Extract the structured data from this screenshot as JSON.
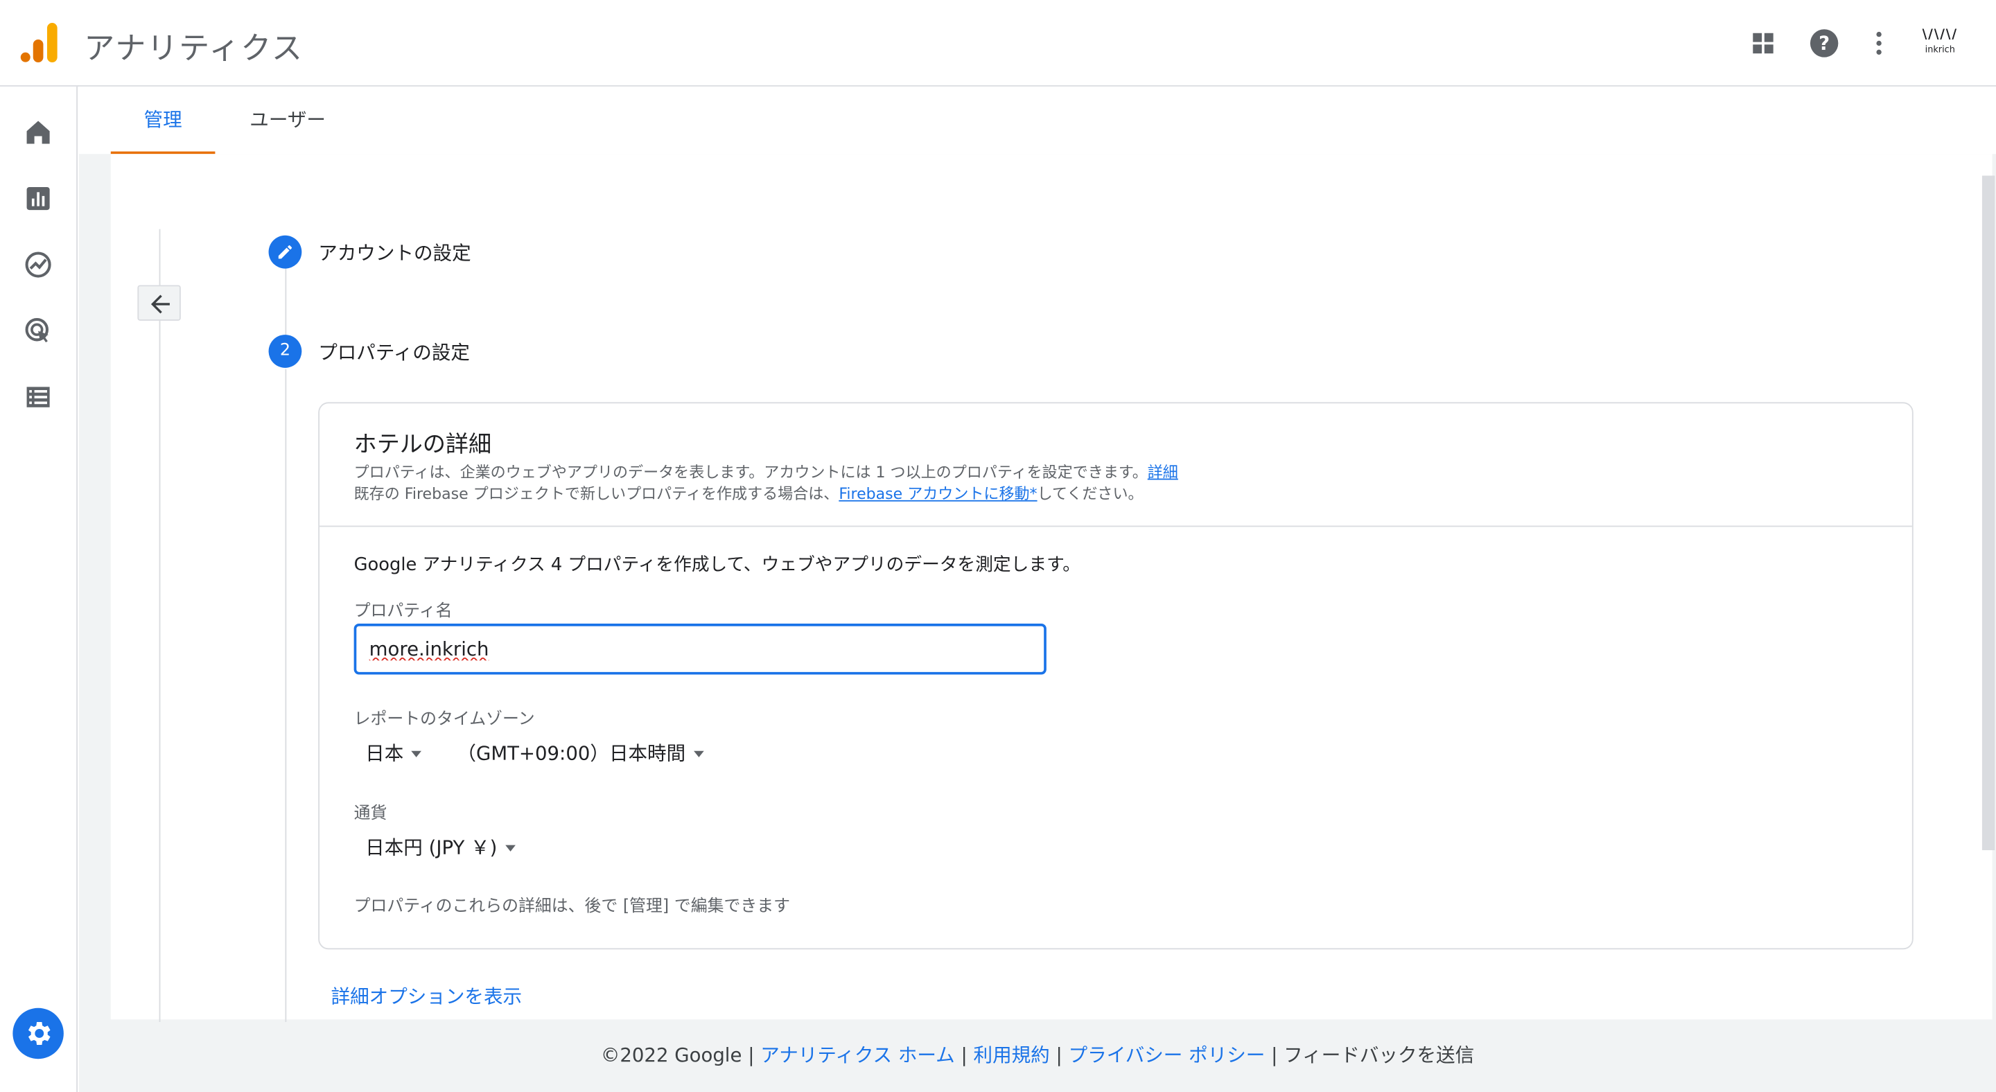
{
  "header": {
    "app_title": "アナリティクス",
    "account_mark": "\\/\\/\\/",
    "account_name": "inkrich"
  },
  "tabs": [
    {
      "label": "管理",
      "active": true
    },
    {
      "label": "ユーザー",
      "active": false
    }
  ],
  "steps": [
    {
      "number": "",
      "label": "アカウントの設定",
      "state": "completed"
    },
    {
      "number": "2",
      "label": "プロパティの設定",
      "state": "current"
    }
  ],
  "details": {
    "title": "ホテルの詳細",
    "desc1_text": "プロパティは、企業のウェブやアプリのデータを表します。アカウントには 1 つ以上のプロパティを設定できます。",
    "desc1_link": "詳細",
    "desc2_prefix": "既存の Firebase プロジェクトで新しいプロパティを作成する場合は、",
    "desc2_link": "Firebase アカウントに移動*",
    "desc2_suffix": "してください。",
    "intro": "Google アナリティクス 4 プロパティを作成して、ウェブやアプリのデータを測定します。",
    "property_name_label": "プロパティ名",
    "property_name_value": "more.inkrich",
    "timezone_label": "レポートのタイムゾーン",
    "country_value": "日本",
    "timezone_value": "（GMT+09:00）日本時間",
    "currency_label": "通貨",
    "currency_value": "日本円 (JPY ￥)",
    "note": "プロパティのこれらの詳細は、後で [管理] で編集できます"
  },
  "advanced_link": "詳細オプションを表示",
  "footer": {
    "copyright": "©2022 Google",
    "links": [
      "アナリティクス ホーム",
      "利用規約",
      "プライバシー ポリシー"
    ],
    "feedback": "フィードバックを送信"
  },
  "colors": {
    "accent": "#1a73e8",
    "tab_underline": "#e8710a",
    "logo_orange": "#f9ab00",
    "logo_dark_orange": "#e37400"
  },
  "icons": {
    "header": [
      "apps-icon",
      "help-icon",
      "more-vert-icon"
    ],
    "nav": [
      "home-icon",
      "reports-icon",
      "explore-icon",
      "advertising-icon",
      "configure-icon"
    ],
    "admin": "gear-icon"
  }
}
